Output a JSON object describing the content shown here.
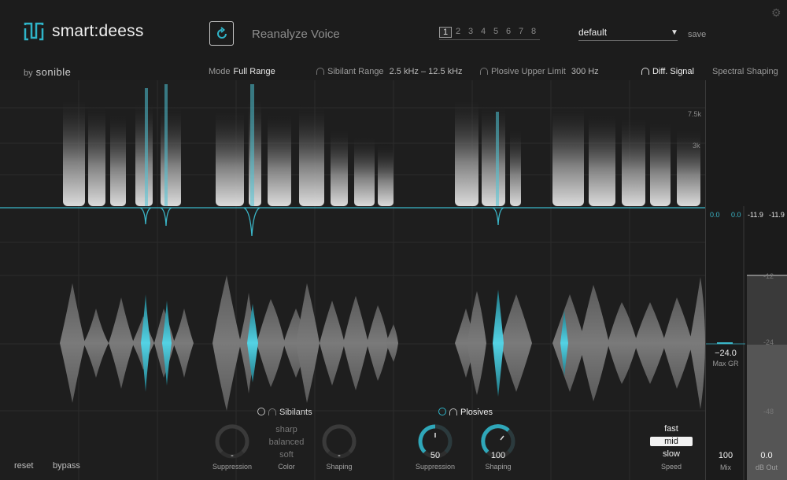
{
  "app": {
    "name": "smart:deess",
    "by_label": "by",
    "brand": "sonible",
    "accent": "#2fb4c8"
  },
  "toolbar": {
    "reanalyze_icon": "refresh-icon",
    "reanalyze_label": "Reanalyze Voice",
    "preset_slots": [
      "1",
      "2",
      "3",
      "4",
      "5",
      "6",
      "7",
      "8"
    ],
    "active_slot": "1",
    "preset_name": "default",
    "save_label": "save"
  },
  "modebar": {
    "mode_label": "Mode",
    "mode_value": "Full Range",
    "sibilant_label": "Sibilant Range",
    "sibilant_value": "2.5 kHz – 12.5 kHz",
    "plosive_label": "Plosive Upper Limit",
    "plosive_value": "300 Hz",
    "diff_label": "Diff. Signal",
    "spectral_label": "Spectral Shaping"
  },
  "freq_axis": [
    "7.5k",
    "3k"
  ],
  "meters": {
    "in_left": "0.0",
    "in_right": "0.0",
    "out_left": "-11.9",
    "out_right": "-11.9",
    "max_gr": "−24.0",
    "max_gr_label": "Max GR",
    "db_ticks": [
      "-12",
      "-24",
      "-48"
    ],
    "mix_value": "100",
    "mix_label": "Mix",
    "out_value": "0.0",
    "out_label": "dB Out"
  },
  "sibilants": {
    "title": "Sibilants",
    "suppression_value": "-",
    "suppression_label": "Suppression",
    "color_options": [
      "sharp",
      "balanced",
      "soft"
    ],
    "color_label": "Color",
    "shaping_value": "-",
    "shaping_label": "Shaping"
  },
  "plosives": {
    "title": "Plosives",
    "suppression_value": "50",
    "suppression_label": "Suppression",
    "shaping_value": "100",
    "shaping_label": "Shaping"
  },
  "speed": {
    "options": [
      "fast",
      "mid",
      "slow"
    ],
    "selected": "mid",
    "label": "Speed"
  },
  "footer": {
    "reset_label": "reset",
    "bypass_label": "bypass"
  }
}
